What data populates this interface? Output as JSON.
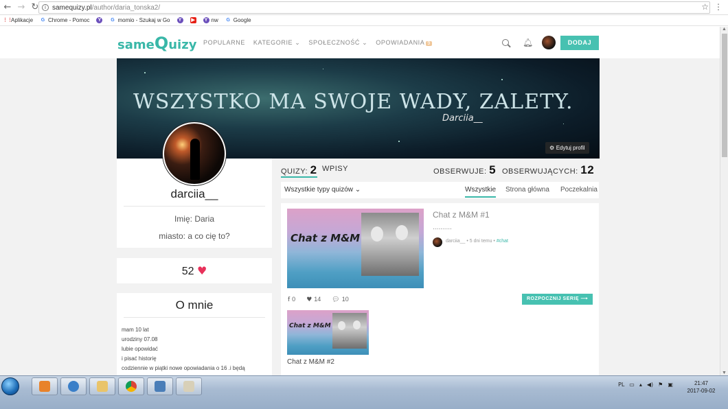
{
  "browser": {
    "url_domain": "samequizy.pl",
    "url_path": "/author/daria_tonska2/",
    "bookmarks": [
      {
        "label": "Aplikacje",
        "icon": "apps-grid-icon"
      },
      {
        "label": "Chrome - Pomoc",
        "icon": "google-icon"
      },
      {
        "label": "",
        "icon": "yahoo-icon"
      },
      {
        "label": "momio - Szukaj w Go",
        "icon": "google-icon"
      },
      {
        "label": "",
        "icon": "yahoo-icon"
      },
      {
        "label": "",
        "icon": "youtube-icon"
      },
      {
        "label": "nw",
        "icon": "yahoo-icon"
      },
      {
        "label": "Google",
        "icon": "google-icon"
      }
    ]
  },
  "nav": {
    "logo_left": "same",
    "logo_q": "Q",
    "logo_right": "uizy",
    "items": [
      {
        "label": "POPULARNE"
      },
      {
        "label": "KATEGORIE ⌄"
      },
      {
        "label": "SPOŁECZNOŚĆ ⌄"
      },
      {
        "label": "OPOWIADANIA",
        "badge": "9"
      }
    ],
    "add_label": "DODAJ"
  },
  "banner": {
    "text": "WSZYSTKO MA SWOJE WADY, ZALETY.",
    "signature": "Darciia__",
    "edit_label": "Edytuj profil"
  },
  "profile": {
    "username": "darciia__",
    "name_label": "Imię:",
    "name_value": "Daria",
    "city_label": "miasto:",
    "city_value": "a co cię to?",
    "likes": "52"
  },
  "about": {
    "title": "O mnie",
    "lines": [
      "mam 10 lat",
      "urodziny 07.08",
      "lubie opowidać",
      "i pisać historię",
      "codziennie w piątki nowe opowiadania o 16 .i będą"
    ]
  },
  "stats": {
    "quizzes_label": "QUIZY:",
    "quizzes_count": "2",
    "posts_label": "WPISY",
    "following_label": "OBSERWUJE:",
    "following_count": "5",
    "followers_label": "OBSERWUJĄCYCH:",
    "followers_count": "12"
  },
  "filters": {
    "type_label": "Wszystkie typy quizów ⌄",
    "tabs": [
      {
        "label": "Wszystkie",
        "active": true
      },
      {
        "label": "Strona główna",
        "active": false
      },
      {
        "label": "Poczekalnia",
        "active": false
      }
    ]
  },
  "feed": {
    "item1": {
      "title": "Chat z M&M #1",
      "thumb_text": "Chat z M&M",
      "description": "..........",
      "author": "darciia__",
      "time": "• 5 dni temu •",
      "tag": "#chat",
      "shares": "0",
      "likes": "14",
      "comments": "10",
      "series_label": "ROZPOCZNIJ SERIĘ ⟶"
    },
    "item2": {
      "title": "Chat z M&M #2",
      "thumb_text": "Chat z M&M"
    }
  },
  "taskbar": {
    "lang": "PL",
    "time": "21:47",
    "date": "2017-09-02"
  },
  "colors": {
    "accent": "#47c1b1",
    "heart": "#e8315a"
  }
}
